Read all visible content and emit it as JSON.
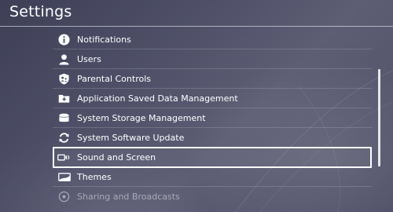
{
  "header": {
    "title": "Settings"
  },
  "menu": {
    "items": [
      {
        "label": "Notifications",
        "icon": "info-icon"
      },
      {
        "label": "Users",
        "icon": "user-icon"
      },
      {
        "label": "Parental Controls",
        "icon": "parental-controls-icon"
      },
      {
        "label": "Application Saved Data Management",
        "icon": "folder-icon"
      },
      {
        "label": "System Storage Management",
        "icon": "storage-icon"
      },
      {
        "label": "System Software Update",
        "icon": "update-icon"
      },
      {
        "label": "Sound and Screen",
        "icon": "sound-screen-icon",
        "selected": true
      },
      {
        "label": "Themes",
        "icon": "themes-icon"
      },
      {
        "label": "Sharing and Broadcasts",
        "icon": "sharing-icon"
      }
    ]
  },
  "colors": {
    "background": "#4f5068",
    "text": "#ffffff",
    "selection_border": "#ffffff"
  }
}
